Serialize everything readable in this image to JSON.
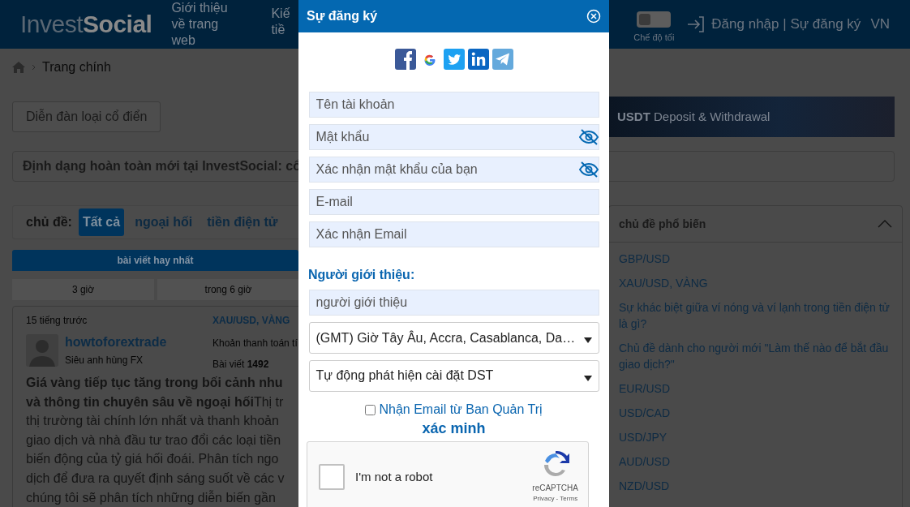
{
  "header": {
    "logo": {
      "part_1": "Invest",
      "part_2": "Social"
    },
    "nav": [
      {
        "label": "Giới thiệu về trang web"
      },
      {
        "label": "Kiế tiề"
      }
    ],
    "dark_mode": {
      "label": "Chế độ tối",
      "on": false
    },
    "auth_link": "Đăng nhập | Sự đăng ký",
    "language": "VN"
  },
  "breadcrumb": [
    "Trang chính"
  ],
  "classic_forum_button": "Diễn đàn loại cổ điển",
  "banner": "**USDT** Deposit & Withdrawal",
  "announcement": "Định dạng hoàn toàn mới tại InvestSocial: cổ",
  "topics": {
    "label": "chủ đề:",
    "tabs": [
      {
        "label": "Tất cả",
        "selected": true
      },
      {
        "label": "ngoại hối",
        "selected": false
      },
      {
        "label": "tiền điện tử",
        "selected": false
      }
    ]
  },
  "best_posts": {
    "title": "bài viết hay nhất",
    "periods": [
      {
        "label": "3 giờ",
        "selected": false
      },
      {
        "label": "trong 6 giờ",
        "selected": false
      }
    ]
  },
  "post": {
    "time": "15 tiếng trước",
    "tag": "XAU/USD, VÀNG",
    "author": "howtoforextrade",
    "rank": "Siêu anh hùng FX",
    "account": "Khoản thanh toán tí",
    "posts": "Bài viết **1492**",
    "lines": [
      "**Giá vàng tiếp tục tăng trong bối cảnh nhu**",
      "**và thông tin chuyên sâu về ngoại hối**Thị tr",
      "thị trường tài chính lớn nhất và thanh khoản",
      "giao dịch và nhà đầu tư trao đổi các loại tiền",
      "biến động của tỷ giá hối đoái. Phân tích ngo",
      "dịch để đưa ra quyết định sáng suốt về các v",
      "chúng tôi sẽ phân tích những diễn biến gần"
    ]
  },
  "popular": {
    "title": "chủ đề phổ biến",
    "expanded": true,
    "items": [
      "GBP/USD",
      "XAU/USD, VÀNG",
      "Sự khác biệt giữa ví nóng và ví lạnh trong tiền điện tử là gì?",
      "Chủ đề dành cho người mới \"Làm thế nào để bắt đầu giao dịch?\"",
      "EUR/USD",
      "USD/CAD",
      "USD/JPY",
      "AUD/USD",
      "NZD/USD"
    ]
  },
  "modal": {
    "title": "Sự đăng ký",
    "social": [
      {
        "kind": "facebook"
      },
      {
        "kind": "google"
      },
      {
        "kind": "twitter"
      },
      {
        "kind": "linkedin"
      },
      {
        "kind": "telegram"
      }
    ],
    "fields": [
      {
        "placeholder": "Tên tài khoản",
        "kind": "text"
      },
      {
        "placeholder": "Mật khẩu",
        "kind": "password"
      },
      {
        "placeholder": "Xác nhận mật khẩu của bạn",
        "kind": "password"
      },
      {
        "placeholder": "E-mail",
        "kind": "text"
      },
      {
        "placeholder": "Xác nhận Email",
        "kind": "text"
      }
    ],
    "referrer_label": "Người giới thiệu:",
    "referrer": {
      "placeholder": "người giới thiệu"
    },
    "selects": [
      "(GMT) Giờ Tây Âu, Accra, Casablanca, Da…",
      "Tự động phát hiện cài đặt DST"
    ],
    "newsletter": {
      "label": "Nhận Email từ Ban Quản Trị",
      "checked": false
    },
    "verify_title": "xác minh",
    "captcha": {
      "label": "I'm not a robot",
      "checked": false,
      "brand": "reCAPTCHA",
      "links": "Privacy - Terms"
    }
  }
}
